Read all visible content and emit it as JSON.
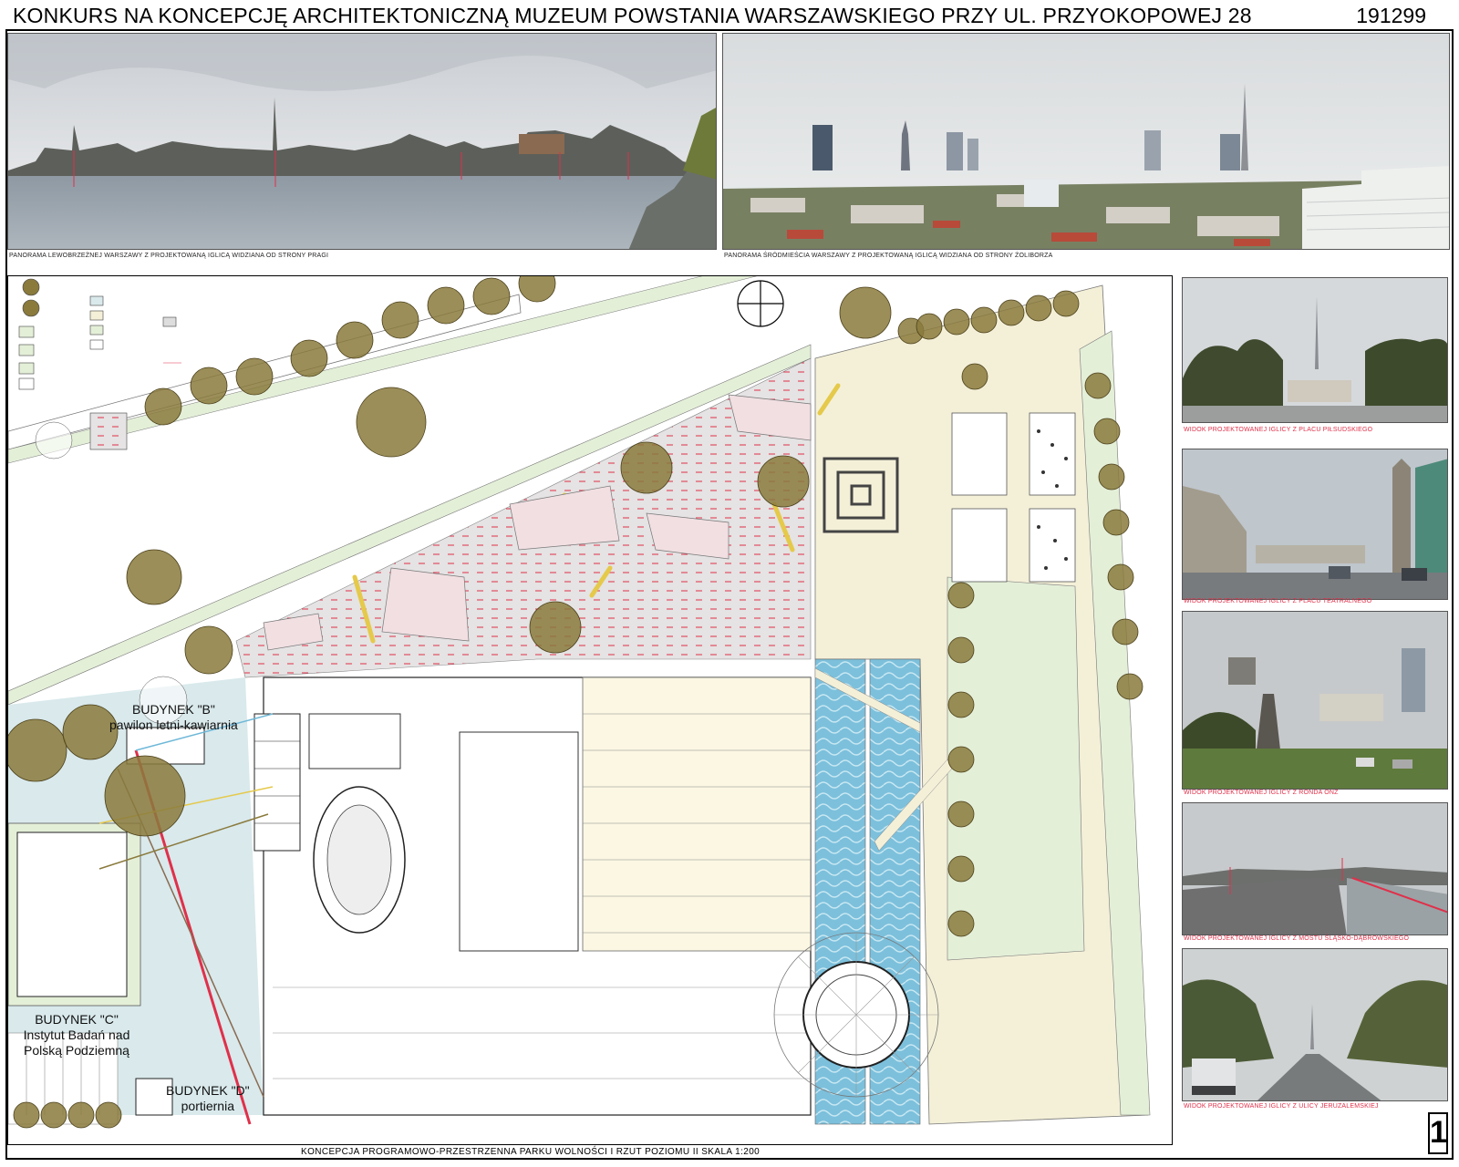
{
  "header": {
    "title": "KONKURS NA KONCEPCJĘ ARCHITEKTONICZNĄ MUZEUM POWSTANIA WARSZAWSKIEGO PRZY UL. PRZYOKOPOWEJ 28",
    "code": "191299"
  },
  "panoramas": {
    "left_caption": "PANORAMA LEWOBRZEŻNEJ WARSZAWY Z PROJEKTOWANĄ IGLICĄ WIDZIANA OD STRONY PRAGI",
    "right_caption": "PANORAMA ŚRÓDMIEŚCIA WARSZAWY Z PROJEKTOWANĄ IGLICĄ WIDZIANA OD STRONY ŻOLIBORZA"
  },
  "views": [
    {
      "caption": "WIDOK PROJEKTOWANEJ IGLICY Z PLACU PIŁSUDSKIEGO"
    },
    {
      "caption": "WIDOK PROJEKTOWANEJ IGLICY Z PLACU TEATRALNEGO"
    },
    {
      "caption": "WIDOK PROJEKTOWANEJ IGLICY Z RONDA ONZ"
    },
    {
      "caption": "WIDOK PROJEKTOWANEJ IGLICY Z MOSTU ŚLĄSKO-DĄBROWSKIEGO"
    },
    {
      "caption": "WIDOK PROJEKTOWANEJ IGLICY Z ULICY JERUZALEMSKIEJ"
    }
  ],
  "plan": {
    "caption": "KONCEPCJA PROGRAMOWO-PRZESTRZENNA PARKU WOLNOŚCI I RZUT POZIOMU II   SKALA 1:200",
    "building_b": [
      "BUDYNEK \"B\"",
      "pawilon letni-kawiarnia"
    ],
    "building_c": [
      "BUDYNEK \"C\"",
      "Instytut Badań nad",
      "Polską Podziemną"
    ],
    "building_d": [
      "BUDYNEK \"D\"",
      "portiernia"
    ]
  },
  "sheet_number": "1",
  "colors": {
    "tree": "#8a7a3c",
    "paving": "#f4f0d8",
    "lawn": "#e4efd8",
    "water": "#6fb8d8",
    "accent_red": "#e0304a",
    "plaza": "#e6eaea"
  }
}
